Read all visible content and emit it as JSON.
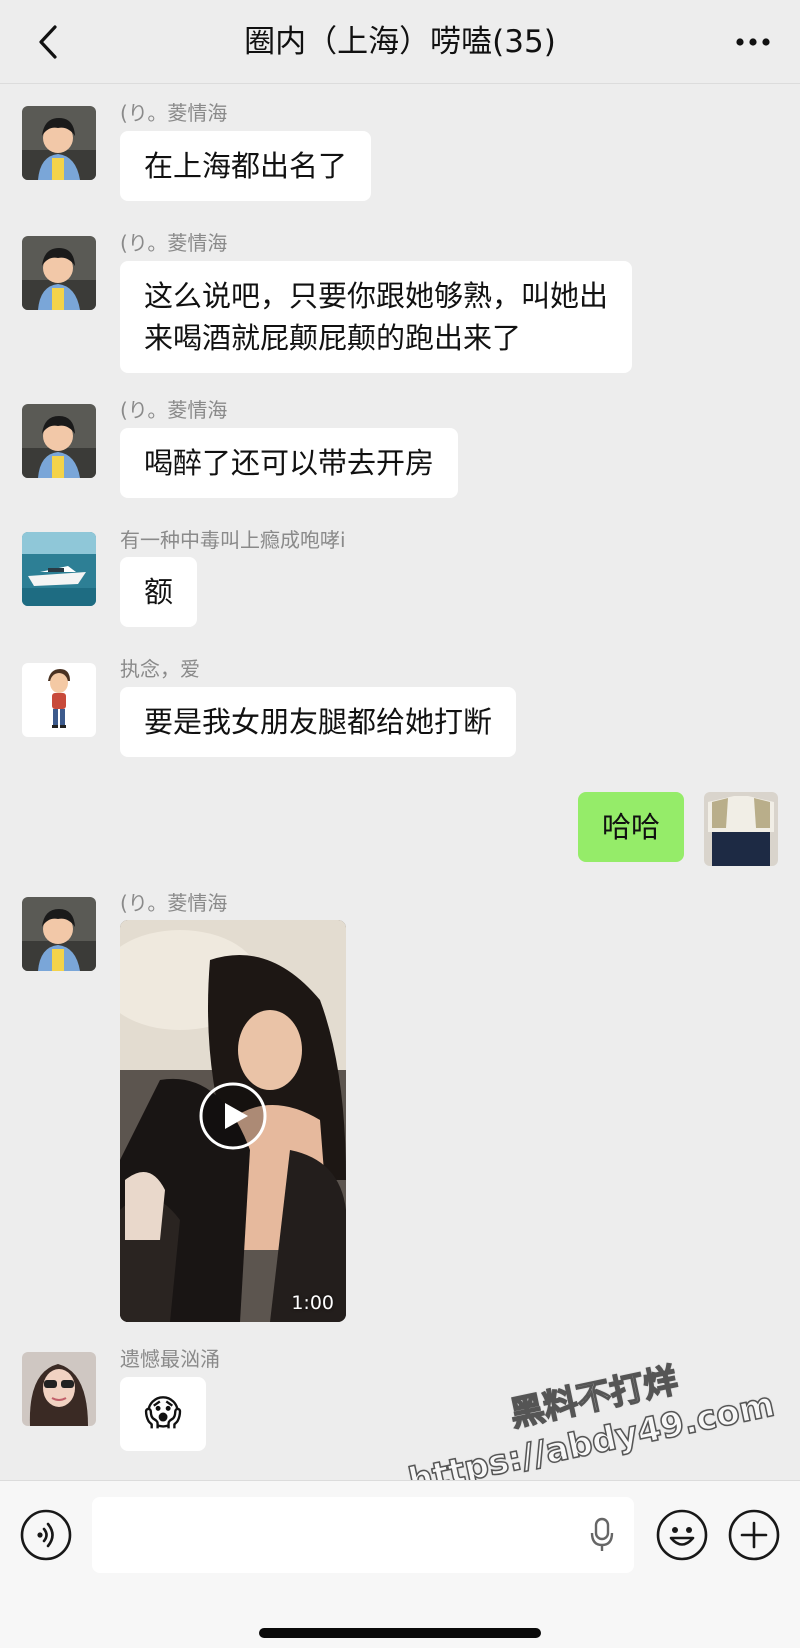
{
  "header": {
    "title": "圈内（上海）唠嗑(35)"
  },
  "messages": [
    {
      "sender": "(り。菱情海",
      "text": "在上海都出名了"
    },
    {
      "sender": "(り。菱情海",
      "lines": [
        "这么说吧，只要你跟她够熟，叫她出",
        "来喝酒就屁颠屁颠的跑出来了"
      ]
    },
    {
      "sender": "(り。菱情海",
      "text": "喝醉了还可以带去开房"
    },
    {
      "sender": "有一种中毒叫上瘾成咆哮i",
      "text": "额"
    },
    {
      "sender": "执念，爱",
      "text": "要是我女朋友腿都给她打断"
    },
    {
      "sender": "self",
      "text": "哈哈"
    },
    {
      "sender": "(り。菱情海",
      "video_duration": "1:00"
    },
    {
      "sender": "遗憾最汹涌",
      "emoji": "😱"
    }
  ],
  "watermark": {
    "line1": "黑料不打烊",
    "line2": "https://abdy49.com"
  },
  "input_bar": {
    "value": ""
  },
  "icons": {
    "back": "chevron-left-icon",
    "more": "more-dots-icon",
    "voice": "voice-icon",
    "mic": "mic-icon",
    "emoji": "emoji-icon",
    "plus": "plus-icon",
    "play": "play-icon"
  },
  "colors": {
    "background": "#ededed",
    "bubble_other": "#ffffff",
    "bubble_self": "#95ec69",
    "sender_name": "#8a8a8a"
  }
}
